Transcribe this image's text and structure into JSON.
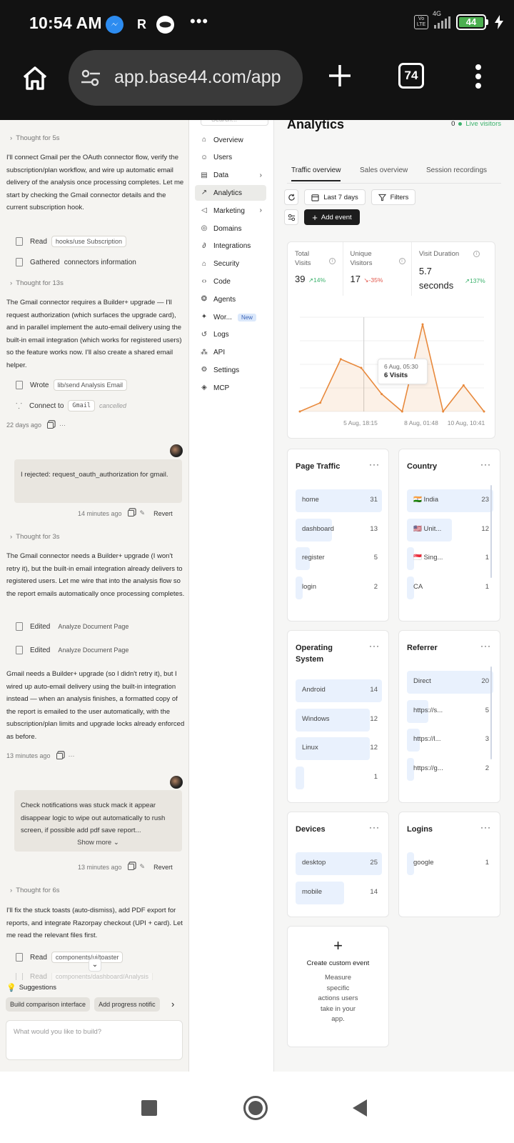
{
  "status_bar": {
    "time": "10:54 AM",
    "dots": "•••",
    "volte": "Vo LTE",
    "network": "4G",
    "battery": "44"
  },
  "browser": {
    "url": "app.base44.com/app",
    "tab_count": "74"
  },
  "chat": {
    "thought1": "Thought for 5s",
    "para1": "I'll connect Gmail per the OAuth connector flow, verify the subscription/plan workflow, and wire up automatic email delivery of the analysis once processing completes. Let me start by checking the Gmail connector details and the current subscription hook.",
    "read1_label": "Read",
    "read1_chip": "hooks/use Subscription",
    "gathered_prefix": "Gathered",
    "gathered_text": "connectors information",
    "thought2": "Thought for 13s",
    "para2": "The Gmail connector requires a Builder+ upgrade — I'll request authorization (which surfaces the upgrade card), and in parallel implement the auto-email delivery using the built-in email integration (which works for registered users) so the feature works now. I'll also create a shared email helper.",
    "wrote_label": "Wrote",
    "wrote_chip": "lib/send Analysis Email",
    "connect_label": "Connect to",
    "connect_chip": "Gmail",
    "connect_status": "cancelled",
    "meta1": "22 days ago",
    "bubble1": "I rejected: request_oauth_authorization for gmail.",
    "meta2": "14 minutes ago",
    "revert": "Revert",
    "thought3": "Thought for 3s",
    "para3": "The Gmail connector needs a Builder+ upgrade (I won't retry it), but the built-in email integration already delivers to registered users. Let me wire that into the analysis flow so the report emails automatically once processing completes.",
    "edited_label": "Edited",
    "edited_chip": "Analyze Document Page",
    "para4": "Gmail needs a Builder+ upgrade (so I didn't retry it), but I wired up auto-email delivery using the built-in integration instead — when an analysis finishes, a formatted copy of the report is emailed to the user automatically, with the subscription/plan limits and upgrade locks already enforced as before.",
    "meta3": "13 minutes ago",
    "bubble2": "Check notifications was stuck mack it appear disappear logic to wipe out automatically to rush screen, if possible add pdf save report...",
    "show_more": "Show more",
    "meta4": "13 minutes ago",
    "thought4": "Thought for 6s",
    "para5": "I'll fix the stuck toasts (auto-dismiss), add PDF export for reports, and integrate Razorpay checkout (UPI + card). Let me read the relevant files first.",
    "read2_label": "Read",
    "read2_chip": "components/ui/toaster",
    "read3_label": "Read",
    "read3_chip": "components/dashboard/Analysis",
    "suggestions": "Suggestions",
    "sugg1": "Build comparison interface",
    "sugg2": "Add progress notific",
    "prompt_placeholder": "What would you like to build?"
  },
  "nav": {
    "search_placeholder": "Search...",
    "items": [
      {
        "label": "Overview",
        "icon": "home-icon"
      },
      {
        "label": "Users",
        "icon": "users-icon"
      },
      {
        "label": "Data",
        "icon": "table-icon"
      },
      {
        "label": "Analytics",
        "icon": "chart-icon"
      },
      {
        "label": "Marketing",
        "icon": "megaphone-icon"
      },
      {
        "label": "Domains",
        "icon": "globe-icon"
      },
      {
        "label": "Integrations",
        "icon": "plug-icon"
      },
      {
        "label": "Security",
        "icon": "lock-icon"
      },
      {
        "label": "Code",
        "icon": "code-icon"
      },
      {
        "label": "Agents",
        "icon": "agent-icon"
      },
      {
        "label": "Wor...",
        "icon": "workflow-icon",
        "badge": "New"
      },
      {
        "label": "Logs",
        "icon": "history-icon"
      },
      {
        "label": "API",
        "icon": "api-icon"
      },
      {
        "label": "Settings",
        "icon": "gear-icon"
      },
      {
        "label": "MCP",
        "icon": "mcp-icon"
      }
    ]
  },
  "analytics": {
    "title": "Analytics",
    "live_count": "0",
    "live_label": "Live visitors",
    "tabs": [
      "Traffic overview",
      "Sales overview",
      "Session recordings"
    ],
    "range": "Last 7 days",
    "filters": "Filters",
    "add_event": "Add event",
    "stats": [
      {
        "label": "Total Visits",
        "value": "39",
        "delta": "14%",
        "trend": "up"
      },
      {
        "label": "Unique Visitors",
        "value": "17",
        "delta": "-35%",
        "trend": "down"
      },
      {
        "label": "Visit Duration",
        "value": "5.7 seconds",
        "delta": "137%",
        "trend": "up"
      }
    ],
    "tooltip": {
      "date": "6 Aug, 05:30",
      "value": "6 Visits"
    },
    "cards": {
      "page_traffic": {
        "title": "Page Traffic",
        "rows": [
          {
            "label": "home",
            "value": 31
          },
          {
            "label": "dashboard",
            "value": 13
          },
          {
            "label": "register",
            "value": 5
          },
          {
            "label": "login",
            "value": 2
          }
        ]
      },
      "country": {
        "title": "Country",
        "rows": [
          {
            "label": "🇮🇳 India",
            "value": 23
          },
          {
            "label": "🇺🇸 Unit...",
            "value": 12
          },
          {
            "label": "🇸🇬 Sing...",
            "value": 1
          },
          {
            "label": "CA",
            "value": 1
          }
        ]
      },
      "os": {
        "title": "Operating System",
        "rows": [
          {
            "label": "Android",
            "value": 14
          },
          {
            "label": "Windows",
            "value": 12
          },
          {
            "label": "Linux",
            "value": 12
          },
          {
            "label": "",
            "value": 1
          }
        ]
      },
      "referrer": {
        "title": "Referrer",
        "rows": [
          {
            "label": "Direct",
            "value": 20
          },
          {
            "label": "https://s...",
            "value": 5
          },
          {
            "label": "https://l...",
            "value": 3
          },
          {
            "label": "https://g...",
            "value": 2
          }
        ]
      },
      "devices": {
        "title": "Devices",
        "rows": [
          {
            "label": "desktop",
            "value": 25
          },
          {
            "label": "mobile",
            "value": 14
          }
        ]
      },
      "logins": {
        "title": "Logins",
        "rows": [
          {
            "label": "google",
            "value": 1
          }
        ]
      }
    },
    "custom_event": {
      "plus": "+",
      "title": "Create custom event",
      "desc": "Measure specific actions users take in your app."
    }
  },
  "chart_data": {
    "type": "area",
    "x_ticks": [
      "5 Aug, 18:15",
      "8 Aug, 01:48",
      "10 Aug, 10:41"
    ],
    "values": [
      0,
      1,
      6,
      5,
      2,
      0,
      10,
      0,
      3,
      0
    ],
    "color": "#e8893c"
  }
}
